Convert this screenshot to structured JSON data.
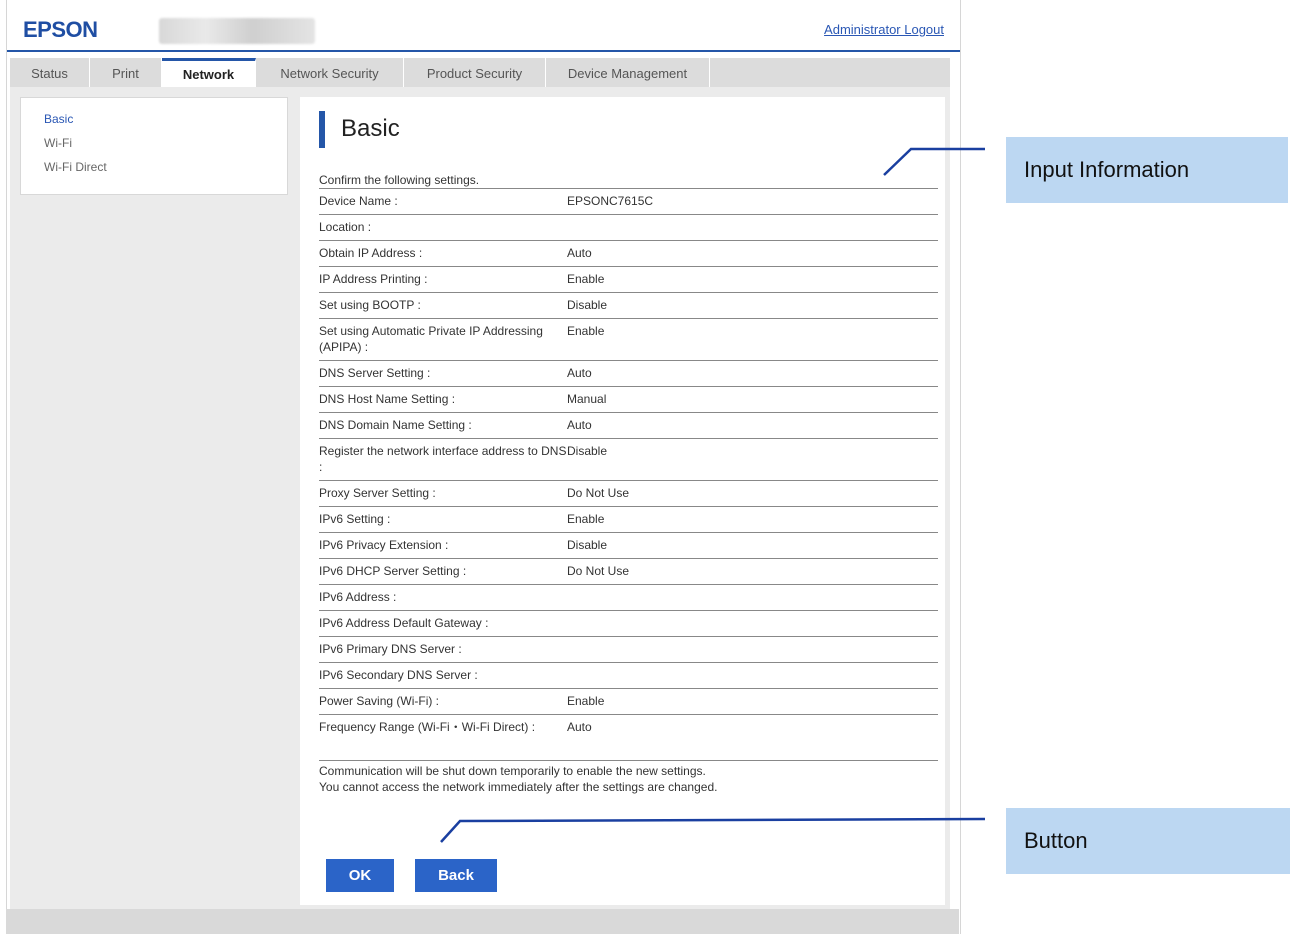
{
  "header": {
    "logo": "EPSON",
    "logout": "Administrator Logout"
  },
  "tabs": [
    {
      "label": "Status",
      "active": false
    },
    {
      "label": "Print",
      "active": false
    },
    {
      "label": "Network",
      "active": true
    },
    {
      "label": "Network Security",
      "active": false
    },
    {
      "label": "Product Security",
      "active": false
    },
    {
      "label": "Device Management",
      "active": false
    }
  ],
  "sidebar": {
    "items": [
      {
        "label": "Basic",
        "active": true
      },
      {
        "label": "Wi-Fi",
        "active": false
      },
      {
        "label": "Wi-Fi Direct",
        "active": false
      }
    ]
  },
  "main": {
    "title": "Basic",
    "confirm": "Confirm the following settings.",
    "rows": [
      {
        "label": "Device Name :",
        "value": "EPSONC7615C"
      },
      {
        "label": "Location :",
        "value": ""
      },
      {
        "label": "Obtain IP Address :",
        "value": "Auto"
      },
      {
        "label": "IP Address Printing :",
        "value": "Enable"
      },
      {
        "label": "Set using BOOTP :",
        "value": "Disable"
      },
      {
        "label": "Set using Automatic Private IP Addressing (APIPA) :",
        "value": "Enable"
      },
      {
        "label": "DNS Server Setting :",
        "value": "Auto"
      },
      {
        "label": "DNS Host Name Setting :",
        "value": "Manual"
      },
      {
        "label": "DNS Domain Name Setting :",
        "value": "Auto"
      },
      {
        "label": "Register the network interface address to DNS :",
        "value": "Disable"
      },
      {
        "label": "Proxy Server Setting :",
        "value": "Do Not Use"
      },
      {
        "label": "IPv6 Setting :",
        "value": "Enable"
      },
      {
        "label": "IPv6 Privacy Extension :",
        "value": "Disable"
      },
      {
        "label": "IPv6 DHCP Server Setting :",
        "value": "Do Not Use"
      },
      {
        "label": "IPv6 Address :",
        "value": ""
      },
      {
        "label": "IPv6 Address Default Gateway :",
        "value": ""
      },
      {
        "label": "IPv6 Primary DNS Server :",
        "value": ""
      },
      {
        "label": "IPv6 Secondary DNS Server :",
        "value": ""
      },
      {
        "label": "Power Saving (Wi-Fi) :",
        "value": "Enable"
      },
      {
        "label": "Frequency Range (Wi-Fi・Wi-Fi Direct) :",
        "value": "Auto"
      }
    ],
    "notice_line1": "Communication will be shut down temporarily to enable the new settings.",
    "notice_line2": "You cannot access the network immediately after the settings are changed.",
    "ok_label": "OK",
    "back_label": "Back"
  },
  "callouts": {
    "input_info": "Input Information",
    "button": "Button"
  },
  "colors": {
    "accent": "#2456a8",
    "button": "#2b64c8",
    "callout": "#bcd7f2"
  }
}
